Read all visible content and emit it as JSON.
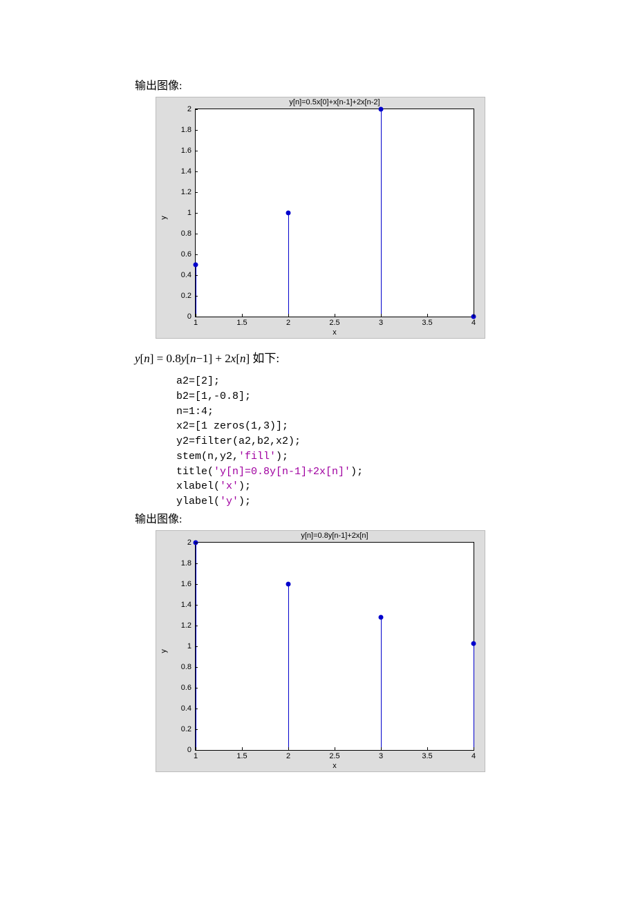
{
  "labels": {
    "caption1": "输出图像:",
    "caption2": "输出图像:",
    "equation": "y[n] = 0.8y[n−1] + 2x[n] 如下:"
  },
  "code": {
    "l1": "a2=[2];",
    "l2": "b2=[1,-0.8];",
    "l3": "n=1:4;",
    "l4": "x2=[1 zeros(1,3)];",
    "l5": "y2=filter(a2,b2,x2);",
    "l6a": "stem(n,y2,",
    "l6b": "'fill'",
    "l6c": ");",
    "l7a": "title(",
    "l7b": "'y[n]=0.8y[n-1]+2x[n]'",
    "l7c": ");",
    "l8a": "xlabel(",
    "l8b": "'x'",
    "l8c": ");",
    "l9a": "ylabel(",
    "l9b": "'y'",
    "l9c": ");"
  },
  "chart_data": [
    {
      "type": "stem",
      "title": "y[n]=0.5x[0]+x[n-1]+2x[n-2]",
      "xlabel": "x",
      "ylabel": "y",
      "xlim": [
        1,
        4
      ],
      "ylim": [
        0,
        2
      ],
      "xticks": [
        1,
        1.5,
        2,
        2.5,
        3,
        3.5,
        4
      ],
      "yticks": [
        0,
        0.2,
        0.4,
        0.6,
        0.8,
        1,
        1.2,
        1.4,
        1.6,
        1.8,
        2
      ],
      "x": [
        1,
        2,
        3,
        4
      ],
      "y": [
        0.5,
        1,
        2,
        0
      ]
    },
    {
      "type": "stem",
      "title": "y[n]=0.8y[n-1]+2x[n]",
      "xlabel": "x",
      "ylabel": "y",
      "xlim": [
        1,
        4
      ],
      "ylim": [
        0,
        2
      ],
      "xticks": [
        1,
        1.5,
        2,
        2.5,
        3,
        3.5,
        4
      ],
      "yticks": [
        0,
        0.2,
        0.4,
        0.6,
        0.8,
        1,
        1.2,
        1.4,
        1.6,
        1.8,
        2
      ],
      "x": [
        1,
        2,
        3,
        4
      ],
      "y": [
        2,
        1.6,
        1.28,
        1.024
      ]
    }
  ]
}
